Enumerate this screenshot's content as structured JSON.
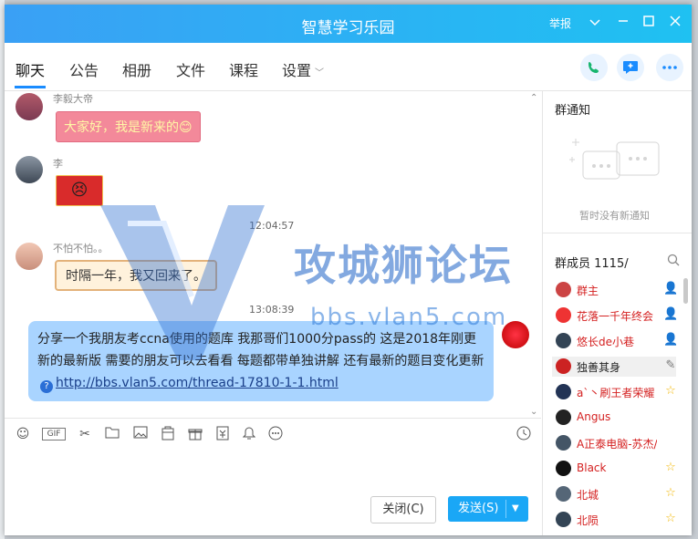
{
  "window": {
    "title": "智慧学习乐园",
    "report": "举报"
  },
  "tabs": [
    {
      "label": "聊天"
    },
    {
      "label": "公告"
    },
    {
      "label": "相册"
    },
    {
      "label": "文件"
    },
    {
      "label": "课程"
    },
    {
      "label": "设置"
    }
  ],
  "messages": {
    "m1": {
      "nick": "李毅大帝",
      "text": "大家好，我是新来的😊"
    },
    "m2": {
      "nick": "李",
      "sticker": "😣"
    },
    "t1": "12:04:57",
    "m3": {
      "nick": "不怕不怕。。",
      "text": "时隔一年，我又回来了。"
    },
    "t2": "13:08:39",
    "m4": {
      "text": "分享一个我朋友考ccna使用的题库 我那哥们1000分pass的 这是2018年刚更新的最新版 需要的朋友可以去看看 每题都带单独讲解 还有最新的题目变化更新",
      "link": "http://bbs.vlan5.com/thread-17810-1-1.html"
    }
  },
  "composer": {
    "close_label": "关闭(C)",
    "send_label": "发送(S)"
  },
  "notice": {
    "title": "群通知",
    "empty": "暂时没有新通知"
  },
  "members": {
    "title": "群成员 1115/",
    "list": [
      {
        "name": "群主",
        "color": "#d42020"
      },
      {
        "name": "花落一千年终会",
        "color": "#d42020"
      },
      {
        "name": "悠长de小巷",
        "color": "#d42020"
      },
      {
        "name": "独善其身",
        "color": "#222222"
      },
      {
        "name": "a`丶刷王者荣耀",
        "color": "#d42020"
      },
      {
        "name": "Angus",
        "color": "#d42020"
      },
      {
        "name": "A正泰电脑-苏杰/ws",
        "color": "#d42020"
      },
      {
        "name": "Black",
        "color": "#d42020"
      },
      {
        "name": "北城",
        "color": "#d42020"
      },
      {
        "name": "北陨",
        "color": "#d42020"
      }
    ]
  },
  "watermark": {
    "main": "攻城狮论坛",
    "sub": "bbs.vlan5.com"
  },
  "colors": {
    "accent": "#1aa7f6",
    "title_grad_start": "#3aa0f5",
    "title_grad_end": "#1fc1f2"
  }
}
